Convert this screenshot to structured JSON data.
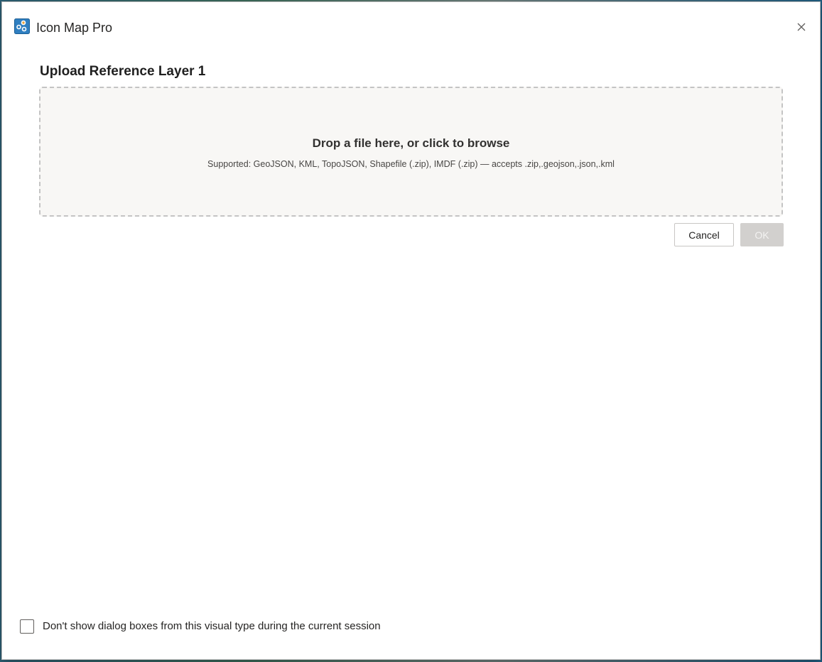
{
  "window": {
    "title": "Icon Map Pro",
    "app_icon": "icon-map-pro-logo",
    "close_icon": "close-icon"
  },
  "dialog": {
    "heading": "Upload Reference Layer 1",
    "dropzone": {
      "title": "Drop a file here, or click to browse",
      "supported": "Supported: GeoJSON, KML, TopoJSON, Shapefile (.zip), IMDF (.zip) — accepts .zip,.geojson,.json,.kml"
    },
    "buttons": {
      "cancel": "Cancel",
      "ok": "OK",
      "ok_disabled": true
    }
  },
  "footer": {
    "checkbox_label": "Don't show dialog boxes from this visual type during the current session",
    "checked": false
  },
  "colors": {
    "accent": "#1f6fb2",
    "dropzone_bg": "#f8f7f5",
    "ok_disabled_bg": "#d2d0ce"
  }
}
